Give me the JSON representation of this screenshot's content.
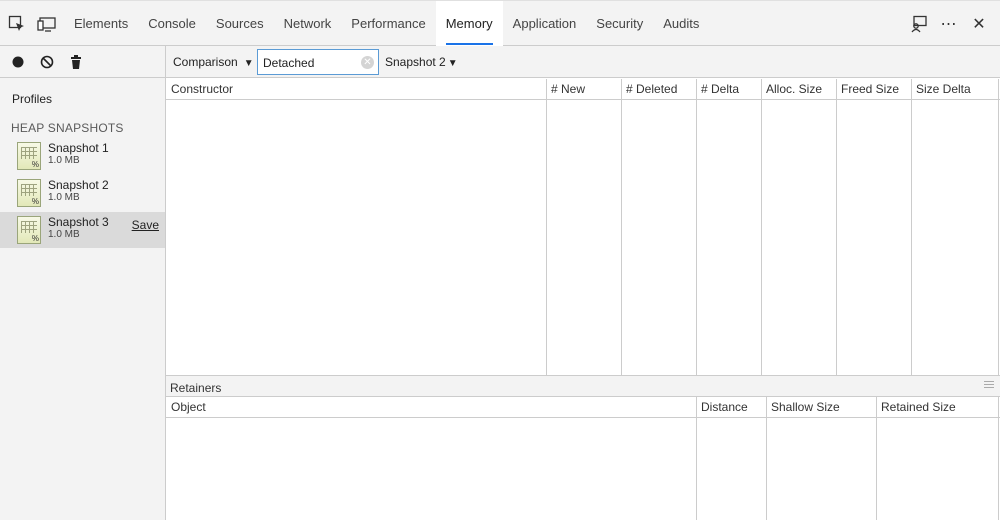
{
  "toolbar_icons": {
    "inspect": "inspect-element-icon",
    "device": "device-mode-icon"
  },
  "tabs": [
    {
      "label": "Elements"
    },
    {
      "label": "Console"
    },
    {
      "label": "Sources"
    },
    {
      "label": "Network"
    },
    {
      "label": "Performance"
    },
    {
      "label": "Memory",
      "active": true
    },
    {
      "label": "Application"
    },
    {
      "label": "Security"
    },
    {
      "label": "Audits"
    }
  ],
  "topright": {
    "feedback": "feedback-icon",
    "more": "⋯",
    "close": "✕"
  },
  "sidebar": {
    "profiles_label": "Profiles",
    "section_label": "HEAP SNAPSHOTS",
    "snapshots": [
      {
        "name": "Snapshot 1",
        "size": "1.0 MB"
      },
      {
        "name": "Snapshot 2",
        "size": "1.0 MB"
      },
      {
        "name": "Snapshot 3",
        "size": "1.0 MB",
        "selected": true,
        "save_label": "Save"
      }
    ]
  },
  "main_toolbar": {
    "view": "Comparison",
    "filter_value": "Detached",
    "base_snapshot": "Snapshot 2"
  },
  "summary_grid": {
    "columns": [
      "Constructor",
      "# New",
      "# Deleted",
      "# Delta",
      "Alloc. Size",
      "Freed Size",
      "Size Delta"
    ]
  },
  "retainers": {
    "label": "Retainers",
    "columns": [
      "Object",
      "Distance",
      "Shallow Size",
      "Retained Size"
    ]
  },
  "colors": {
    "accent": "#1a73e8",
    "panel_bg": "#f3f3f3",
    "selected_bg": "#dadada",
    "border": "#cccccc"
  }
}
